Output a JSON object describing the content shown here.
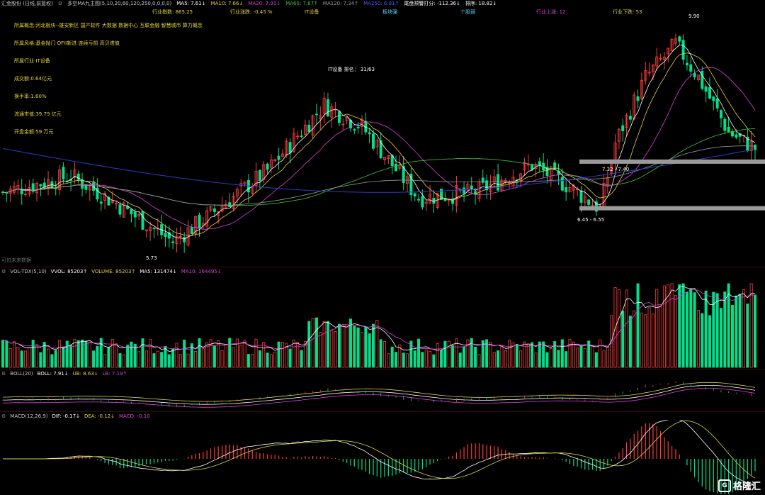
{
  "header": {
    "stock": "汇金股份 (日线,前复权)",
    "indicator": "多空MA九主图(5,10,20,60,120,250,0,0,0,0)",
    "ma5": "MA5: 7.61↓",
    "ma10": "MA10: 7.66↓",
    "ma20": "MA20: 7.91↓",
    "ma60": "MA60: 7.87↑",
    "ma120": "MA120: 7.34↑",
    "ma250": "MA250: 6.81↑",
    "tail": "尾盘预警打分: -112.36↓",
    "rank": "排序: 18.82↓"
  },
  "row2": {
    "index": "行业指数: 865.25",
    "change": "行业涨跌: -0.45 %",
    "it": "IT设备",
    "board": "板块强",
    "stock": "个股弱",
    "up": "行业上涨: 12",
    "down": "行业下跌: 53"
  },
  "info": {
    "concept": "所属概念:河北板块--雄安新区 国产软件 大数据 数据中心 互联金融 智慧城市 算力概念",
    "style": "所属风格:基金抛门 QFII新进 连续亏损 高贝塔值",
    "industry": "所属行业:IT设备",
    "volume": "成交额:0.64亿元",
    "turnover": "换手率:1.60%",
    "float_cap": "流通市值:39.79 亿元",
    "open_amount": "开盘金额:59 万元"
  },
  "chart": {
    "rank_text": "IT设备 排名： 31/63",
    "high_label": "9.90",
    "low_label": "5.73",
    "band_upper": "7.32 - 7.40",
    "band_lower": "6.45 - 6.55",
    "future_note": "可包未来数据"
  },
  "vol": {
    "title": "VOL-TDX(5,10)",
    "vvol": "VVOL: 85203↑",
    "volume": "VOLUME: 85203↑",
    "ma5": "MA5: 131474↓",
    "ma10": "MA10: 164495↓"
  },
  "boll": {
    "title": "BOLL(20)",
    "boll": "BOLL: 7.91↓",
    "ub": "UB: 8.63↓",
    "lb": "LB: 7.19↑"
  },
  "macd": {
    "title": "MACD(12,26,9)",
    "dif": "DIF: -0.17↓",
    "dea": "DEA: -0.12↓",
    "macd": "MACD: -0.10"
  },
  "watermark": "格隆汇",
  "colors": {
    "up": "#ff3b3b",
    "down": "#00e08a",
    "ma5": "#ffffff",
    "ma10": "#e6d23a",
    "ma20": "#e040e0",
    "ma60": "#3cc83c",
    "ma120": "#9a9a9a",
    "ma250": "#2a3cc8",
    "band": "#9a9a9a"
  }
}
